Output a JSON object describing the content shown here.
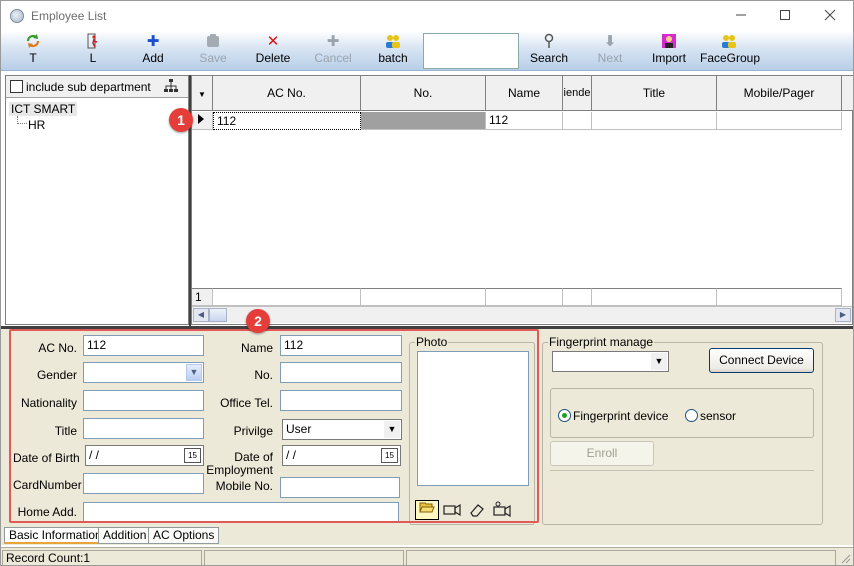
{
  "window": {
    "title": "Employee List",
    "minimize_icon": "minimize-icon",
    "maximize_icon": "maximize-icon",
    "close_icon": "close-icon"
  },
  "toolbar": {
    "buttons": [
      {
        "label": "T",
        "icon": "refresh-icon",
        "enabled": true
      },
      {
        "label": "L",
        "icon": "leave-icon",
        "enabled": true
      },
      {
        "label": "Add",
        "icon": "plus-icon",
        "enabled": true
      },
      {
        "label": "Save",
        "icon": "save-icon",
        "enabled": false
      },
      {
        "label": "Delete",
        "icon": "delete-x-icon",
        "enabled": true
      },
      {
        "label": "Cancel",
        "icon": "cancel-icon",
        "enabled": false
      },
      {
        "label": "batch",
        "icon": "people-icon",
        "enabled": true
      },
      {
        "label": "Search",
        "icon": "search-key-icon",
        "enabled": true
      },
      {
        "label": "Next",
        "icon": "next-arrow-icon",
        "enabled": false
      },
      {
        "label": "Import",
        "icon": "import-icon",
        "enabled": true
      },
      {
        "label": "FaceGroup",
        "icon": "face-group-icon",
        "enabled": true
      }
    ],
    "search_value": ""
  },
  "left_panel": {
    "include_sub_department_label": "include sub department",
    "include_sub_department_checked": false,
    "tree": {
      "root": "ICT SMART",
      "children": [
        "HR"
      ]
    }
  },
  "grid": {
    "columns": [
      "AC No.",
      "No.",
      "Name",
      "iende",
      "Title",
      "Mobile/Pager"
    ],
    "rows": [
      {
        "ac_no": "112",
        "no": "",
        "name": "112",
        "iende": "",
        "title": "",
        "mobile": ""
      }
    ],
    "footer_row": "1",
    "badge_1": "1"
  },
  "form": {
    "badge_2": "2",
    "ac_no_label": "AC No.",
    "ac_no_value": "112",
    "name_label": "Name",
    "name_value": "112",
    "gender_label": "Gender",
    "gender_value": "",
    "no_label": "No.",
    "no_value": "",
    "nationality_label": "Nationality",
    "nationality_value": "",
    "office_tel_label": "Office Tel.",
    "office_tel_value": "",
    "title_label": "Title",
    "title_value": "",
    "privilege_label": "Privilge",
    "privilege_value": "User",
    "dob_label": "Date of Birth",
    "dob_value": " /  /",
    "doe_label_1": "Date of",
    "doe_label_2": "Employment",
    "doe_value": " /  /",
    "cardnumber_label": "CardNumber",
    "cardnumber_value": "",
    "mobile_label": "Mobile No.",
    "mobile_value": "",
    "home_add_label": "Home Add.",
    "home_add_value": "",
    "photo_label": "Photo"
  },
  "fingerprint": {
    "group_label": "Fingerprint manage",
    "device_select_value": "",
    "connect_button": "Connect Device",
    "radio_device": "Fingerprint device",
    "radio_sensor": "sensor",
    "selected_radio": "Fingerprint device",
    "enroll_button": "Enroll"
  },
  "tabs": [
    {
      "label": "Basic Information",
      "active": true
    },
    {
      "label": "Addition",
      "active": false
    },
    {
      "label": "AC Options",
      "active": false
    }
  ],
  "status": {
    "record_count": "Record Count:1"
  }
}
